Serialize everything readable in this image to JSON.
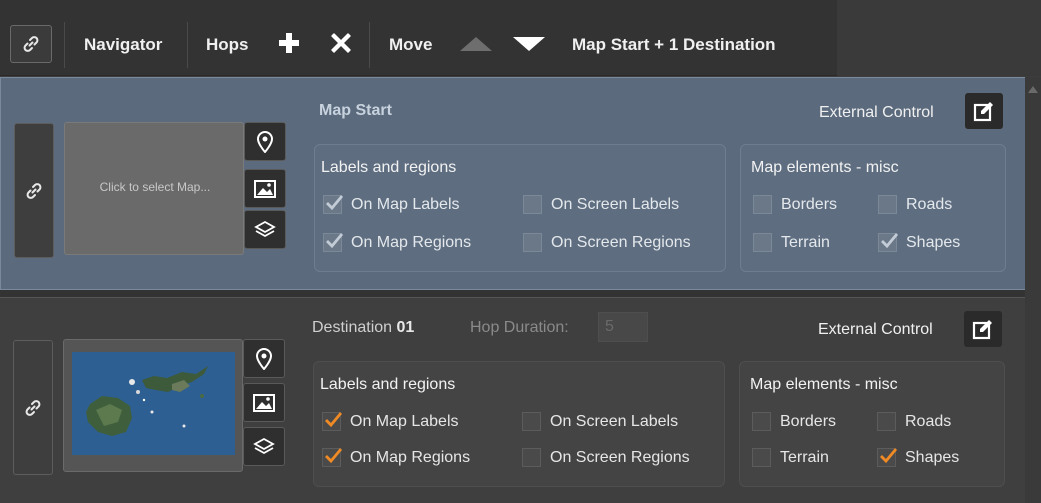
{
  "toolbar": {
    "navigator_label": "Navigator",
    "hops_label": "Hops",
    "move_label": "Move",
    "summary": "Map Start + 1 Destination",
    "icons": [
      "link-icon",
      "plus-icon",
      "close-icon",
      "arrow-up-icon",
      "arrow-down-icon"
    ]
  },
  "map_start": {
    "title": "Map Start",
    "thumbnail_prompt": "Click to select Map...",
    "external_control": "External Control",
    "labels_group": {
      "title": "Labels and regions",
      "items": [
        {
          "label": "On Map Labels",
          "checked": true
        },
        {
          "label": "On Screen Labels",
          "checked": false
        },
        {
          "label": "On Map Regions",
          "checked": true
        },
        {
          "label": "On Screen Regions",
          "checked": false
        }
      ]
    },
    "misc_group": {
      "title": "Map elements - misc",
      "items": [
        {
          "label": "Borders",
          "checked": false
        },
        {
          "label": "Roads",
          "checked": false
        },
        {
          "label": "Terrain",
          "checked": false
        },
        {
          "label": "Shapes",
          "checked": true
        }
      ]
    }
  },
  "destination": {
    "label": "Destination",
    "number": "01",
    "hop_label": "Hop Duration:",
    "hop_value": "5",
    "external_control": "External Control",
    "labels_group": {
      "title": "Labels and regions",
      "items": [
        {
          "label": "On Map Labels",
          "checked": true
        },
        {
          "label": "On Screen Labels",
          "checked": false
        },
        {
          "label": "On Map Regions",
          "checked": true
        },
        {
          "label": "On Screen Regions",
          "checked": false
        }
      ]
    },
    "misc_group": {
      "title": "Map elements - misc",
      "items": [
        {
          "label": "Borders",
          "checked": false
        },
        {
          "label": "Roads",
          "checked": false
        },
        {
          "label": "Terrain",
          "checked": false
        },
        {
          "label": "Shapes",
          "checked": true
        }
      ]
    }
  },
  "colors": {
    "check_active": "#f08a24",
    "check_dim": "#c3ccd6",
    "panel_selected": "#5b6b7d"
  }
}
